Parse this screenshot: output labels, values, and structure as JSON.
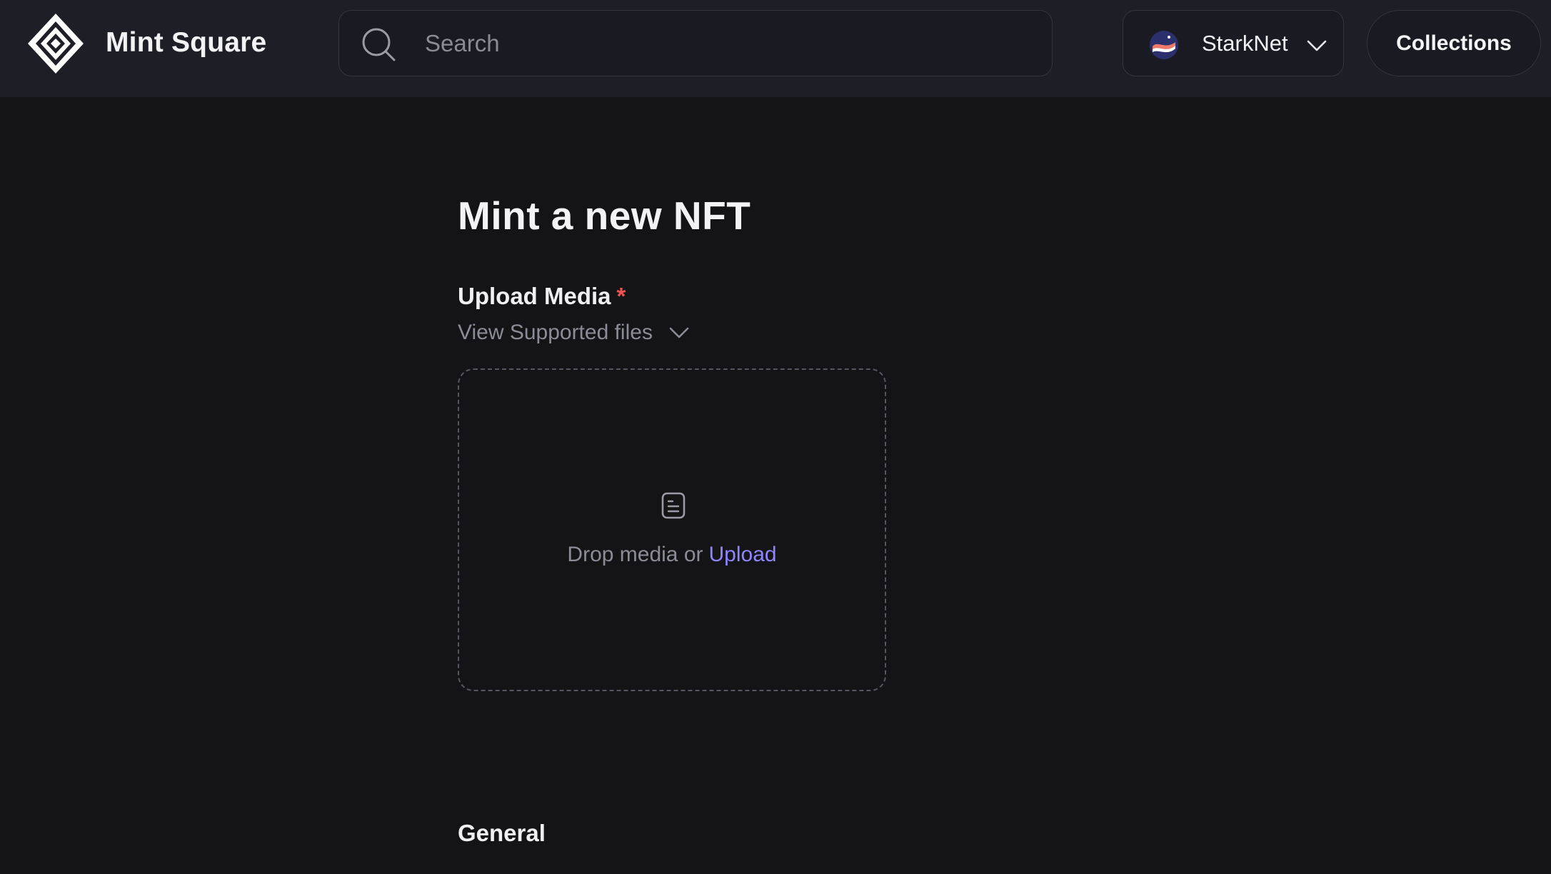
{
  "header": {
    "brand": "Mint Square",
    "search_placeholder": "Search",
    "network_label": "StarkNet",
    "collections_label": "Collections"
  },
  "main": {
    "title": "Mint a new NFT",
    "upload_label": "Upload Media",
    "required_mark": "*",
    "supported_files_label": "View Supported files",
    "drop_text": "Drop media or",
    "upload_link": "Upload",
    "section_general": "General"
  },
  "icons": {
    "logo": "mint-square-logo-icon",
    "search": "search-icon",
    "network": "starknet-icon",
    "chevron": "chevron-down-icon",
    "file": "file-icon"
  },
  "colors": {
    "background": "#141416",
    "header": "#1d1e26",
    "accent_link": "#8f86ff",
    "required": "#ef5350"
  }
}
